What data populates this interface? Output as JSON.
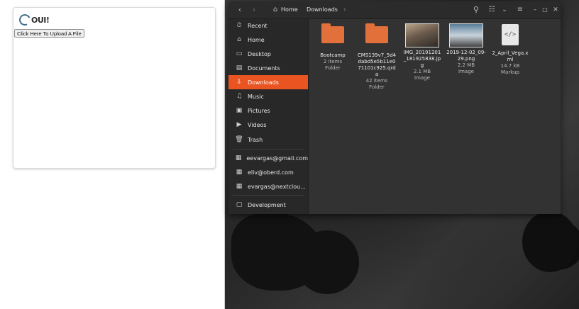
{
  "browser": {
    "logo_text": "OUI!",
    "upload_button_label": "Click Here To Upload A File"
  },
  "file_manager": {
    "header": {
      "back_icon": "‹",
      "forward_icon": "›",
      "home_icon": "⌂",
      "path_home": "Home",
      "path_current": "Downloads",
      "more_icon": "›",
      "search_icon": "⚲",
      "view_icon": "☷",
      "sort_icon": "⌄",
      "menu_icon": "≡",
      "minimize_icon": "–",
      "maximize_icon": "□",
      "close_icon": "✕"
    },
    "sidebar": {
      "items": [
        {
          "label": "Recent",
          "icon": "⏱"
        },
        {
          "label": "Home",
          "icon": "⌂"
        },
        {
          "label": "Desktop",
          "icon": "▭"
        },
        {
          "label": "Documents",
          "icon": "▤"
        },
        {
          "label": "Downloads",
          "icon": "⇩"
        },
        {
          "label": "Music",
          "icon": "♫"
        },
        {
          "label": "Pictures",
          "icon": "▣"
        },
        {
          "label": "Videos",
          "icon": "▶"
        },
        {
          "label": "Trash",
          "icon": "🗑"
        }
      ],
      "accounts": [
        {
          "label": "eevargas@gmail.com",
          "icon": "▦"
        },
        {
          "label": "eliv@oberd.com",
          "icon": "▦"
        },
        {
          "label": "evargas@nextclou...",
          "icon": "▦"
        }
      ],
      "bookmarks": [
        {
          "label": "Development",
          "icon": "▢"
        }
      ],
      "active_color": "#e95420"
    },
    "files": [
      {
        "name": "Bootcamp",
        "meta1": "2 items",
        "meta2": "Folder",
        "type": "folder"
      },
      {
        "name": "CMS139v7_5d4dabd5e5b11e071101c925.qrda",
        "meta1": "42 items",
        "meta2": "Folder",
        "type": "folder"
      },
      {
        "name": "IMG_20191201_181925838.jpg",
        "meta1": "2.1 MB",
        "meta2": "Image",
        "type": "image"
      },
      {
        "name": "2019-12-02_09-29.png",
        "meta1": "2.2 MB",
        "meta2": "Image",
        "type": "image"
      },
      {
        "name": "2_April_Vega.xml",
        "meta1": "14.7 kB",
        "meta2": "Markup",
        "type": "markup"
      }
    ],
    "folder_color": "#e2703a"
  }
}
